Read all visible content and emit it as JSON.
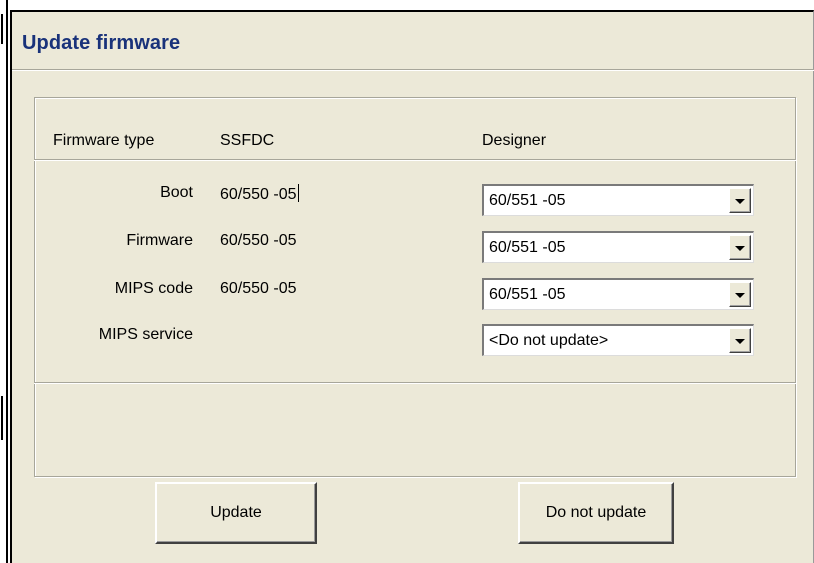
{
  "dialog": {
    "title": "Update firmware"
  },
  "table": {
    "header": {
      "firmware_type": "Firmware type",
      "ssfdc": "SSFDC",
      "designer": "Designer"
    },
    "rows": [
      {
        "label": "Boot",
        "ssfdc": "60/550 -05",
        "designer": "60/551 -05"
      },
      {
        "label": "Firmware",
        "ssfdc": "60/550 -05",
        "designer": "60/551 -05"
      },
      {
        "label": "MIPS code",
        "ssfdc": "60/550 -05",
        "designer": "60/551 -05"
      },
      {
        "label": "MIPS service",
        "ssfdc": "",
        "designer": "<Do not update>"
      }
    ]
  },
  "buttons": {
    "update": "Update",
    "do_not_update": "Do not update"
  },
  "icons": {
    "dropdown": "chevron-down-icon"
  },
  "colors": {
    "title_text": "#19327a",
    "dialog_bg": "#ece9d8"
  }
}
